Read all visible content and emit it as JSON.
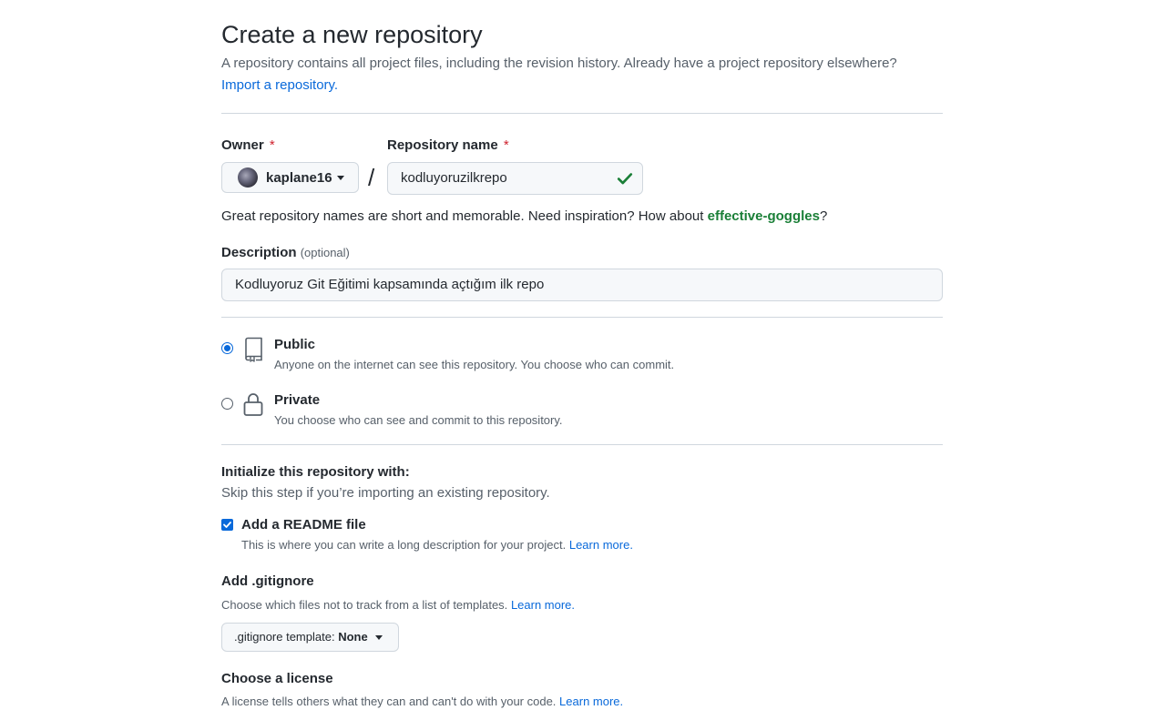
{
  "header": {
    "title": "Create a new repository",
    "subtitle": "A repository contains all project files, including the revision history. Already have a project repository elsewhere?",
    "import_link": "Import a repository."
  },
  "owner": {
    "label": "Owner",
    "required_mark": "*",
    "value": "kaplane16"
  },
  "repo_name": {
    "label": "Repository name",
    "required_mark": "*",
    "separator": "/",
    "value": "kodluyoruzilkrepo"
  },
  "name_hint": {
    "text": "Great repository names are short and memorable. Need inspiration? How about ",
    "suggestion": "effective-goggles",
    "suffix": "?"
  },
  "description": {
    "label": "Description",
    "optional": "(optional)",
    "value": "Kodluyoruz Git Eğitimi kapsamında açtığım ilk repo"
  },
  "visibility": {
    "public": {
      "title": "Public",
      "description": "Anyone on the internet can see this repository. You choose who can commit.",
      "selected": true
    },
    "private": {
      "title": "Private",
      "description": "You choose who can see and commit to this repository.",
      "selected": false
    }
  },
  "initialize": {
    "title": "Initialize this repository with:",
    "subtitle": "Skip this step if you’re importing an existing repository.",
    "readme": {
      "label": "Add a README file",
      "checked": true,
      "description": "This is where you can write a long description for your project.",
      "learn_more": "Learn more."
    }
  },
  "gitignore": {
    "title": "Add .gitignore",
    "description": "Choose which files not to track from a list of templates.",
    "learn_more": "Learn more.",
    "select_prefix": ".gitignore template:",
    "select_value": "None"
  },
  "license": {
    "title": "Choose a license",
    "description": "A license tells others what they can and can't do with your code.",
    "learn_more": "Learn more."
  },
  "colors": {
    "accent": "#0969da",
    "success": "#1a7f37",
    "danger": "#cf222e"
  }
}
